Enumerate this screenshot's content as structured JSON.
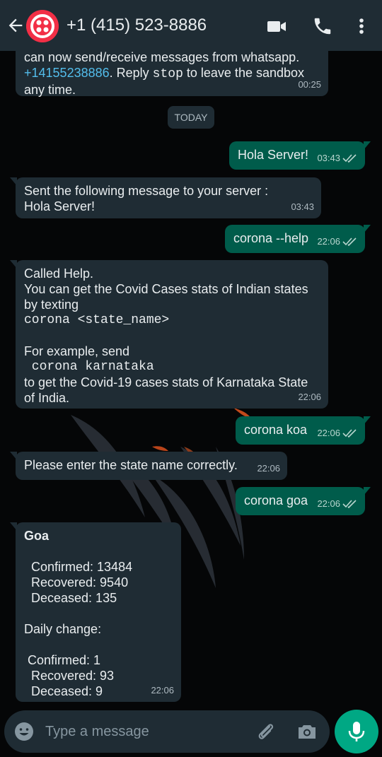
{
  "header": {
    "contact_name": "+1 (415) 523-8886"
  },
  "date_chip": "TODAY",
  "messages": {
    "m0": {
      "line1": "can now send/receive messages from whatsapp.",
      "link": "+14155238886",
      "line2a": ". Reply ",
      "line2_code": "stop",
      "line2b": " to leave the sandbox",
      "line3": "any time.",
      "time": "00:25"
    },
    "m1": {
      "text": "Hola Server!",
      "time": "03:43"
    },
    "m2": {
      "line1": "Sent the following message to your server :",
      "line2": "Hola Server!",
      "time": "03:43"
    },
    "m3": {
      "text": "corona --help",
      "time": "22:06"
    },
    "m4": {
      "line1": "Called Help.",
      "line2": "You can get the Covid Cases stats of Indian states",
      "line3": "by texting",
      "line4": "corona <state_name>",
      "line5": "For example, send",
      "line6": " corona karnataka",
      "line7": "to get the Covid-19 cases stats of Karnataka State",
      "line8": "of India.",
      "time": "22:06"
    },
    "m5": {
      "text": "corona koa",
      "time": "22:06"
    },
    "m6": {
      "text": "Please enter the state name correctly.",
      "time": "22:06"
    },
    "m7": {
      "text": "corona goa",
      "time": "22:06"
    },
    "m8": {
      "title": "Goa",
      "confirmed": "  Confirmed: 13484",
      "recovered": "  Recovered: 9540",
      "deceased": "  Deceased: 135",
      "daily": "Daily change:",
      "d_confirmed": " Confirmed: 1",
      "d_recovered": "  Recovered: 93",
      "d_deceased": "  Deceased: 9",
      "time": "22:06"
    }
  },
  "input": {
    "placeholder": "Type a message"
  },
  "colors": {
    "header": "#1f2c34",
    "incoming": "#1f2c34",
    "outgoing": "#005c4b",
    "accent": "#00a884",
    "twilio_red": "#f22f46"
  },
  "icons": [
    "back-arrow-icon",
    "twilio-logo-icon",
    "video-call-icon",
    "phone-icon",
    "more-vertical-icon",
    "double-check-icon",
    "emoji-icon",
    "attach-icon",
    "camera-icon",
    "mic-icon"
  ]
}
